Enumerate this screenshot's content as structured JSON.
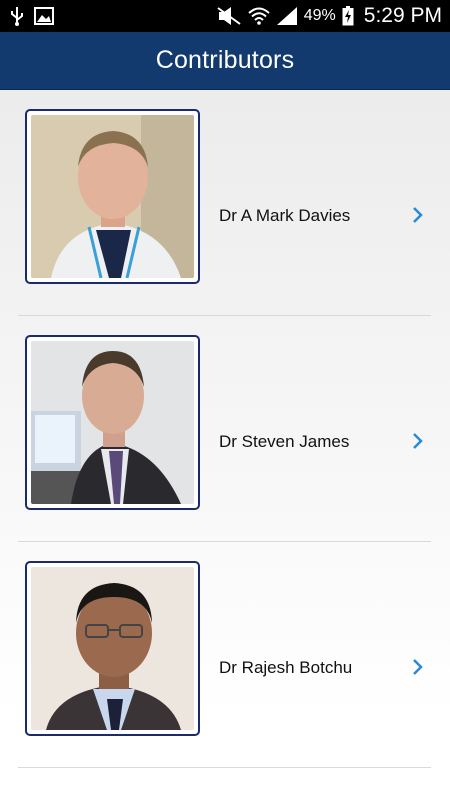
{
  "status_bar": {
    "battery_percent": "49%",
    "time": "5:29 PM",
    "left_icons": [
      "usb-icon",
      "image-icon"
    ],
    "right_icons": [
      "mute-icon",
      "wifi-icon",
      "signal-icon",
      "battery-charging-icon"
    ]
  },
  "app_bar": {
    "title": "Contributors"
  },
  "contributors": [
    {
      "name": "Dr A Mark Davies"
    },
    {
      "name": "Dr Steven James"
    },
    {
      "name": "Dr Rajesh Botchu"
    }
  ],
  "colors": {
    "app_bar": "#123a6e",
    "chevron": "#2a8ad6",
    "photo_border": "#1a2a6c"
  }
}
